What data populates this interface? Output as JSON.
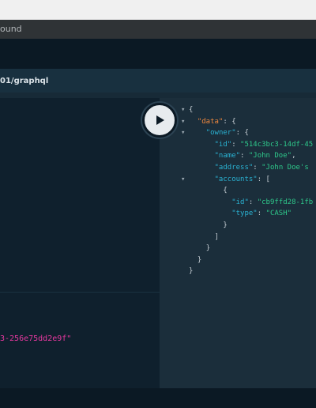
{
  "window": {
    "title": "ound"
  },
  "url": "01/graphql",
  "variables": {
    "text": "3-256e75dd2e9f\""
  },
  "result": {
    "lines": [
      {
        "fold": "▾",
        "indent": "",
        "key": "",
        "sep": "",
        "value": "",
        "tail": "{"
      },
      {
        "fold": "▾",
        "indent": "  ",
        "key": "\"data\"",
        "sep": ": ",
        "value": "",
        "tail": "{"
      },
      {
        "fold": "▾",
        "indent": "    ",
        "key": "\"owner\"",
        "sep": ": ",
        "value": "",
        "tail": "{"
      },
      {
        "fold": "",
        "indent": "      ",
        "key": "\"id\"",
        "sep": ": ",
        "value": "\"514c3bc3-14df-45",
        "tail": ""
      },
      {
        "fold": "",
        "indent": "      ",
        "key": "\"name\"",
        "sep": ": ",
        "value": "\"John Doe\"",
        "tail": ","
      },
      {
        "fold": "",
        "indent": "      ",
        "key": "\"address\"",
        "sep": ": ",
        "value": "\"John Doe's",
        "tail": ""
      },
      {
        "fold": "▾",
        "indent": "      ",
        "key": "\"accounts\"",
        "sep": ": ",
        "value": "",
        "tail": "["
      },
      {
        "fold": "",
        "indent": "        ",
        "key": "",
        "sep": "",
        "value": "",
        "tail": "{"
      },
      {
        "fold": "",
        "indent": "          ",
        "key": "\"id\"",
        "sep": ": ",
        "value": "\"cb9ffd28-1fb",
        "tail": ""
      },
      {
        "fold": "",
        "indent": "          ",
        "key": "\"type\"",
        "sep": ": ",
        "value": "\"CASH\"",
        "tail": ""
      },
      {
        "fold": "",
        "indent": "        ",
        "key": "",
        "sep": "",
        "value": "",
        "tail": "}"
      },
      {
        "fold": "",
        "indent": "      ",
        "key": "",
        "sep": "",
        "value": "",
        "tail": "]"
      },
      {
        "fold": "",
        "indent": "    ",
        "key": "",
        "sep": "",
        "value": "",
        "tail": "}"
      },
      {
        "fold": "",
        "indent": "  ",
        "key": "",
        "sep": "",
        "value": "",
        "tail": "}"
      },
      {
        "fold": "",
        "indent": "",
        "key": "",
        "sep": "",
        "value": "",
        "tail": "}"
      }
    ]
  },
  "icons": {
    "run": "play-icon"
  },
  "colors": {
    "key": "#2ab2d2",
    "data_key": "#f0883e",
    "string": "#2ec98b",
    "variable_string": "#e5389f",
    "background": "#1a2a36"
  }
}
